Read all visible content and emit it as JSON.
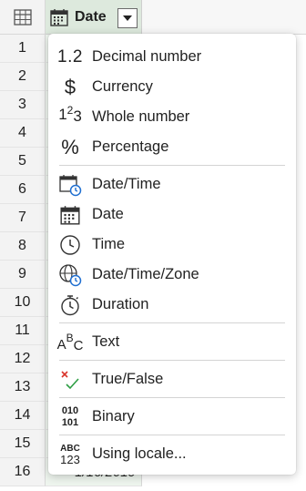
{
  "column_header": {
    "label": "Date",
    "type_icon": "calendar-icon",
    "dropdown_icon": "caret-down-icon"
  },
  "rows": [
    {
      "num": "1"
    },
    {
      "num": "2"
    },
    {
      "num": "3"
    },
    {
      "num": "4"
    },
    {
      "num": "5"
    },
    {
      "num": "6"
    },
    {
      "num": "7"
    },
    {
      "num": "8"
    },
    {
      "num": "9"
    },
    {
      "num": "10"
    },
    {
      "num": "11"
    },
    {
      "num": "12"
    },
    {
      "num": "13"
    },
    {
      "num": "14"
    },
    {
      "num": "15"
    },
    {
      "num": "16",
      "date": "1/16/2019"
    }
  ],
  "menu": {
    "items": [
      {
        "label": "Decimal number",
        "icon": "decimal-icon",
        "glyph": "1.2"
      },
      {
        "label": "Currency",
        "icon": "currency-icon",
        "glyph": "$"
      },
      {
        "label": "Whole number",
        "icon": "whole-number-icon"
      },
      {
        "label": "Percentage",
        "icon": "percentage-icon",
        "glyph": "%"
      },
      {
        "label": "Date/Time",
        "icon": "datetime-icon"
      },
      {
        "label": "Date",
        "icon": "calendar-icon"
      },
      {
        "label": "Time",
        "icon": "clock-icon"
      },
      {
        "label": "Date/Time/Zone",
        "icon": "globe-clock-icon"
      },
      {
        "label": "Duration",
        "icon": "stopwatch-icon"
      },
      {
        "label": "Text",
        "icon": "text-abc-icon"
      },
      {
        "label": "True/False",
        "icon": "true-false-icon"
      },
      {
        "label": "Binary",
        "icon": "binary-icon",
        "glyph_top": "010",
        "glyph_bottom": "101"
      },
      {
        "label": "Using locale...",
        "icon": "locale-icon",
        "glyph_top": "ABC",
        "glyph_bottom": "123"
      }
    ]
  },
  "colors": {
    "header_selected": "#dde9dd",
    "cell_selected": "#eef5ee",
    "accent_blue": "#1f6fd1",
    "false_red": "#d9342b",
    "true_green": "#2e9e44"
  }
}
